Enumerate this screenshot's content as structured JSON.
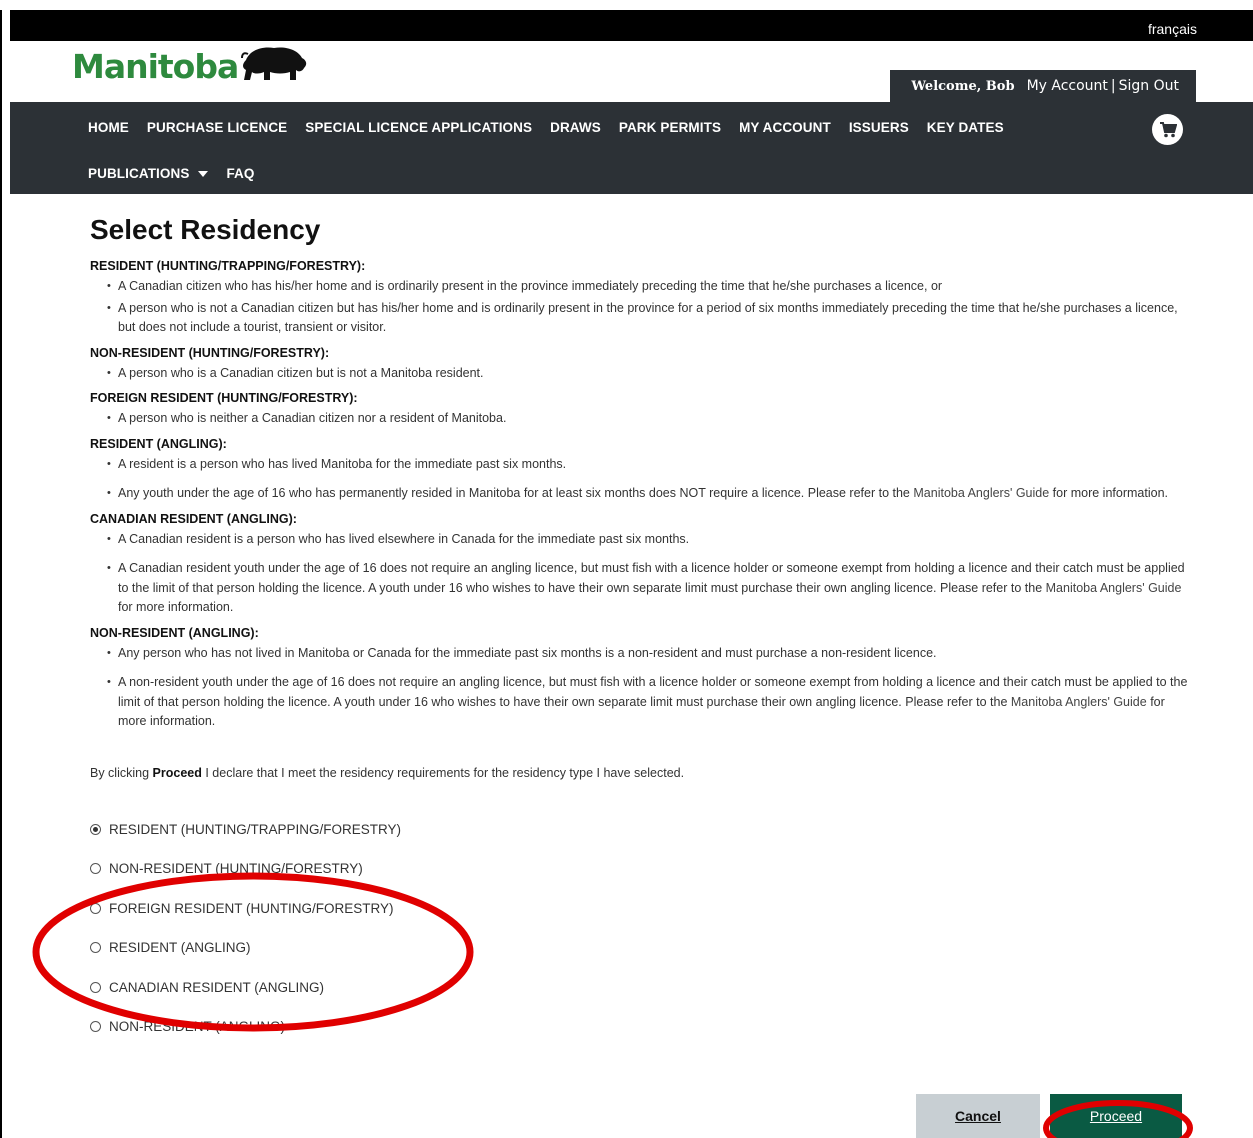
{
  "header": {
    "language_link": "français",
    "logo_text": "Manitoba",
    "welcome": "Welcome, Bob",
    "my_account": "My Account",
    "separator": "|",
    "sign_out": "Sign Out"
  },
  "nav": {
    "row1": [
      "HOME",
      "PURCHASE LICENCE",
      "SPECIAL LICENCE APPLICATIONS",
      "DRAWS",
      "PARK PERMITS",
      "MY ACCOUNT",
      "ISSUERS",
      "KEY DATES"
    ],
    "publications": "PUBLICATIONS",
    "faq": "FAQ",
    "cart_icon": "shopping-cart-icon"
  },
  "page": {
    "title": "Select Residency"
  },
  "definitions": {
    "resident_htf": {
      "heading": "RESIDENT (HUNTING/TRAPPING/FORESTRY):",
      "b1": "A Canadian citizen who has his/her home and is ordinarily present in the province immediately preceding the time that he/she purchases a licence, or",
      "b2": "A person who is not a Canadian citizen but has his/her home and is ordinarily present in the province for a period of six months immediately preceding the time that he/she purchases a licence, but does not include a tourist, transient or visitor."
    },
    "nonresident_hf": {
      "heading": "NON-RESIDENT (HUNTING/FORESTRY):",
      "b1": "A person who is a Canadian citizen but is not a Manitoba resident."
    },
    "foreign_hf": {
      "heading": "FOREIGN RESIDENT (HUNTING/FORESTRY):",
      "b1": "A person who is neither a Canadian citizen nor a resident of Manitoba."
    },
    "resident_angling": {
      "heading": "RESIDENT (ANGLING):",
      "b1": "A resident is a person who has lived Manitoba for the immediate past six months.",
      "b2_pre": "Any youth under the age of 16 who has permanently resided in Manitoba for at least six months does NOT require a licence. Please refer to the",
      "b2_link": "Manitoba Anglers' Guide",
      "b2_post": "for more information."
    },
    "canadian_angling": {
      "heading": "CANADIAN RESIDENT (ANGLING):",
      "b1": "A Canadian resident is a person who has lived elsewhere in Canada for the immediate past six months.",
      "b2_pre": "A Canadian resident youth under the age of 16 does not require an angling licence, but must fish with a licence holder or someone exempt from holding a licence and their catch must be applied to the limit of that person holding the licence. A youth under 16 who wishes to have their own separate limit must purchase their own angling licence. Please refer to the",
      "b2_link": "Manitoba Anglers' Guide",
      "b2_post": "for more information."
    },
    "nonresident_angling": {
      "heading": "NON-RESIDENT (ANGLING):",
      "b1": "Any person who has not lived in Manitoba or Canada for the immediate past six months is a non-resident and must purchase a non-resident licence.",
      "b2_pre": "A non-resident youth under the age of 16 does not require an angling licence, but must fish with a licence holder or someone exempt from holding a licence and their catch must be applied to the limit of that person holding the licence. A youth under 16 who wishes to have their own separate limit must purchase their own angling licence. Please refer to the",
      "b2_link": "Manitoba Anglers' Guide",
      "b2_post": "for more information."
    }
  },
  "declaration": {
    "pre": "By clicking",
    "bold": "Proceed",
    "post": "I declare that I meet the residency requirements for the residency type I have selected."
  },
  "options": [
    {
      "label": "RESIDENT (HUNTING/TRAPPING/FORESTRY)",
      "checked": true
    },
    {
      "label": "NON-RESIDENT (HUNTING/FORESTRY)",
      "checked": false
    },
    {
      "label": "FOREIGN RESIDENT (HUNTING/FORESTRY)",
      "checked": false
    },
    {
      "label": "RESIDENT (ANGLING)",
      "checked": false
    },
    {
      "label": "CANADIAN RESIDENT (ANGLING)",
      "checked": false
    },
    {
      "label": "NON-RESIDENT (ANGLING)",
      "checked": false
    }
  ],
  "buttons": {
    "cancel": "Cancel",
    "proceed": "Proceed"
  },
  "colors": {
    "brand_green": "#2e8a3e",
    "nav_bg": "#2c3136",
    "proceed_bg": "#0a5a43",
    "annotation_red": "#e00000"
  }
}
